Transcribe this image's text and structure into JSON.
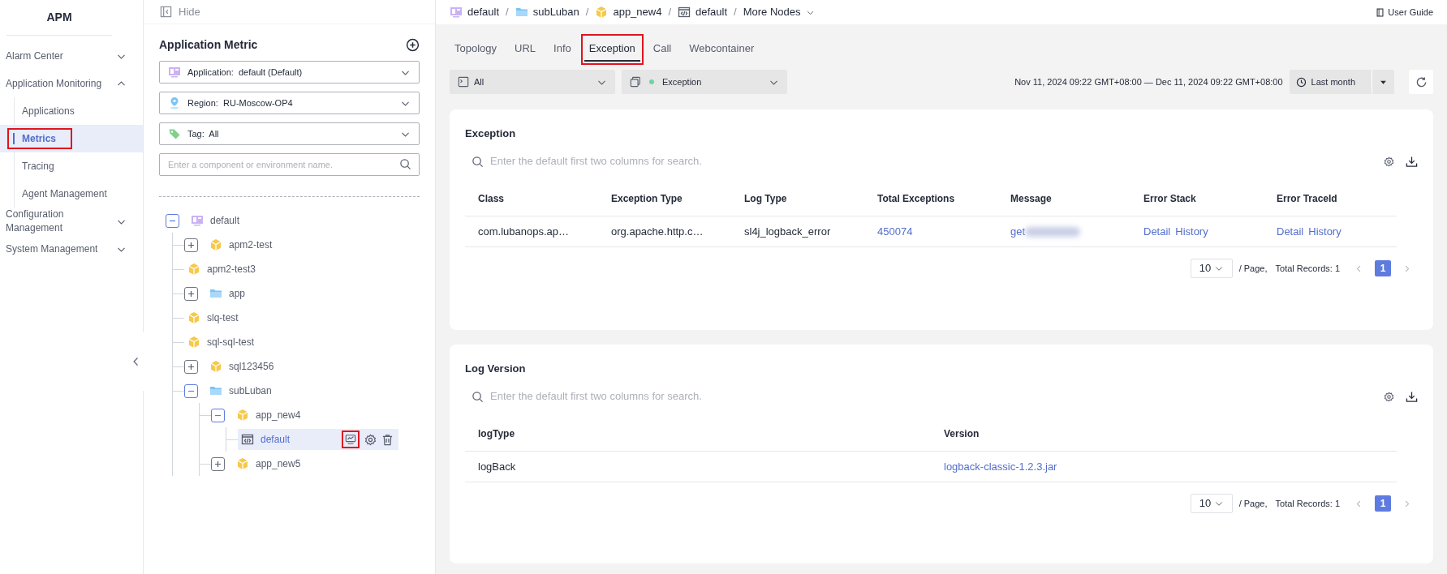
{
  "sidebar": {
    "title": "APM",
    "items": [
      {
        "label": "Alarm Center",
        "expanded": false
      },
      {
        "label": "Application Monitoring",
        "expanded": true,
        "children": [
          {
            "label": "Applications",
            "selected": false
          },
          {
            "label": "Metrics",
            "selected": true
          },
          {
            "label": "Tracing",
            "selected": false
          },
          {
            "label": "Agent Management",
            "selected": false
          }
        ]
      },
      {
        "label": "Configuration Management",
        "expanded": false
      },
      {
        "label": "System Management",
        "expanded": false
      }
    ]
  },
  "panel": {
    "hide_label": "Hide",
    "title": "Application Metric",
    "selects": [
      {
        "kind": "application",
        "label": "Application:",
        "value": "default (Default)"
      },
      {
        "kind": "region",
        "label": "Region:",
        "value": "RU-Moscow-OP4"
      },
      {
        "kind": "tag",
        "label": "Tag:",
        "value": "All"
      }
    ],
    "search": {
      "placeholder": "Enter a component or environment name."
    },
    "tree": [
      {
        "label": "default",
        "kind": "app",
        "expanded": true,
        "selected": false,
        "children": [
          {
            "label": "apm2-test",
            "kind": "cube",
            "expanded": false,
            "selected": false
          },
          {
            "label": "apm2-test3",
            "kind": "cube",
            "selected": false
          },
          {
            "label": "app",
            "kind": "folder",
            "expanded": false,
            "selected": false
          },
          {
            "label": "slq-test",
            "kind": "cube",
            "selected": false
          },
          {
            "label": "sql-sql-test",
            "kind": "cube",
            "selected": false
          },
          {
            "label": "sql123456",
            "kind": "cube",
            "expanded": false,
            "selected": false
          },
          {
            "label": "subLuban",
            "kind": "folder",
            "expanded": true,
            "selected": false,
            "children": [
              {
                "label": "app_new4",
                "kind": "cube",
                "expanded": true,
                "selected": false,
                "children": [
                  {
                    "label": "default",
                    "kind": "env",
                    "selected": true
                  }
                ]
              },
              {
                "label": "app_new5",
                "kind": "cube",
                "expanded": false,
                "selected": false
              }
            ]
          }
        ]
      }
    ]
  },
  "breadcrumb": [
    {
      "label": "default",
      "kind": "app"
    },
    {
      "label": "subLuban",
      "kind": "folder"
    },
    {
      "label": "app_new4",
      "kind": "cube"
    },
    {
      "label": "default",
      "kind": "env"
    },
    {
      "label": "More Nodes",
      "kind": "menu"
    }
  ],
  "breadcrumb_separator": "/",
  "user_guide": "User Guide",
  "tabs": [
    {
      "label": "Topology",
      "selected": false
    },
    {
      "label": "URL",
      "selected": false
    },
    {
      "label": "Info",
      "selected": false
    },
    {
      "label": "Exception",
      "selected": true
    },
    {
      "label": "Call",
      "selected": false
    },
    {
      "label": "Webcontainer",
      "selected": false
    }
  ],
  "filters": [
    {
      "kind": "instance",
      "value": "All"
    },
    {
      "kind": "monitor",
      "value": "Exception"
    }
  ],
  "time_range": "Nov 11, 2024 09:22 GMT+08:00 — Dec 11, 2024 09:22 GMT+08:00",
  "time_preset": "Last month",
  "cards": [
    {
      "title": "Exception",
      "search_placeholder": "Enter the default first two columns for search.",
      "columns": [
        "Class",
        "Exception Type",
        "Log Type",
        "Total Exceptions",
        "Message",
        "Error Stack",
        "Error TraceId"
      ],
      "rows": [
        [
          {
            "kind": "text",
            "text": "com.lubanops.ap…"
          },
          {
            "kind": "text",
            "text": "org.apache.http.c…"
          },
          {
            "kind": "text",
            "text": "sl4j_logback_error"
          },
          {
            "kind": "link",
            "text": "450074"
          },
          {
            "kind": "blurred",
            "text": "get"
          },
          {
            "kind": "links",
            "links": [
              "Detail",
              "History"
            ]
          },
          {
            "kind": "links",
            "links": [
              "Detail",
              "History"
            ]
          }
        ]
      ],
      "page_size": "10",
      "page_label": "/ Page,",
      "total": "Total Records: 1",
      "pages": [
        {
          "label": "1",
          "selected": true
        }
      ]
    },
    {
      "title": "Log Version",
      "search_placeholder": "Enter the default first two columns for search.",
      "columns": [
        "logType",
        "Version"
      ],
      "rows": [
        [
          {
            "kind": "text",
            "text": "logBack"
          },
          {
            "kind": "link",
            "text": "logback-classic-1.2.3.jar"
          }
        ]
      ],
      "page_size": "10",
      "page_label": "/ Page,",
      "total": "Total Records: 1",
      "pages": [
        {
          "label": "1",
          "selected": true
        }
      ]
    }
  ]
}
